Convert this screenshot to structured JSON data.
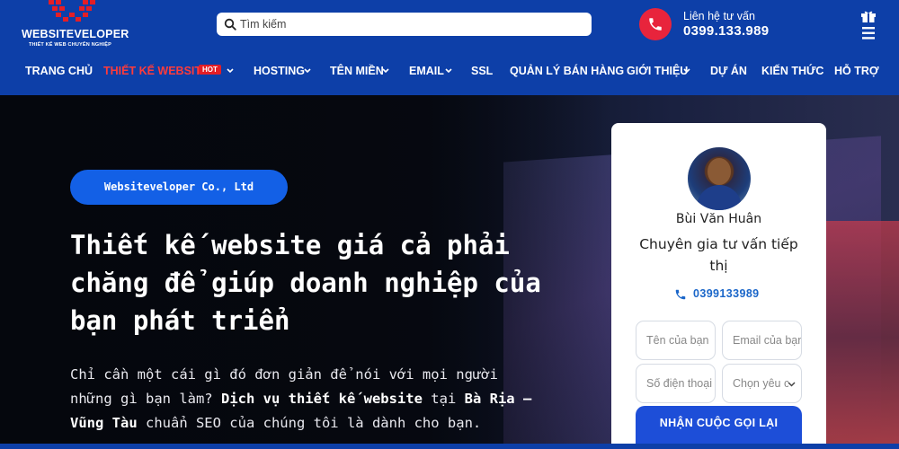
{
  "brand": {
    "logo_text": "WEBSITEVELOPER",
    "tagline": "THIẾT KẾ WEB CHUYÊN NGHIỆP"
  },
  "search": {
    "placeholder": "Tìm kiếm"
  },
  "contact": {
    "label": "Liên hệ tư vấn",
    "phone": "0399.133.989"
  },
  "nav": {
    "items": [
      {
        "label": "TRANG CHỦ"
      },
      {
        "label": "THIẾT KẾ WEBSITE",
        "badge": "HOT"
      },
      {
        "label": "HOSTING"
      },
      {
        "label": "TÊN MIỀN"
      },
      {
        "label": "EMAIL"
      },
      {
        "label": "SSL"
      },
      {
        "label": "QUẢN LÝ BÁN HÀNG"
      },
      {
        "label": "GIỚI THIỆU"
      },
      {
        "label": "DỰ ÁN"
      },
      {
        "label": "KIẾN THỨC"
      },
      {
        "label": "HỖ TRỢ"
      }
    ]
  },
  "hero": {
    "company": "Websiteveloper Co., Ltd",
    "title": "Thiết kế website giá cả phải chăng để giúp doanh nghiệp của bạn phát triển",
    "desc_part1": "Chỉ cần một cái gì đó đơn giản để nói với mọi người những gì bạn làm? ",
    "desc_bold1": "Dịch vụ thiết kế website",
    "desc_part2": " tại ",
    "desc_bold2": "Bà Rịa – Vũng Tàu",
    "desc_part3": " chuẩn SEO của chúng tôi là dành cho bạn."
  },
  "card": {
    "name": "Bùi Văn Huân",
    "role": "Chuyên gia tư vấn tiếp thị",
    "phone": "0399133989",
    "name_placeholder": "Tên của bạn",
    "email_placeholder": "Email của bạn",
    "phone_placeholder": "Số điện thoại",
    "select_value": "Chọn yêu cầu",
    "submit": "NHẬN CUỘC GỌI LẠI"
  },
  "colors": {
    "brand_blue": "#0d3fa8",
    "hot_red": "#e41e26",
    "accent_blue": "#1360e6"
  }
}
